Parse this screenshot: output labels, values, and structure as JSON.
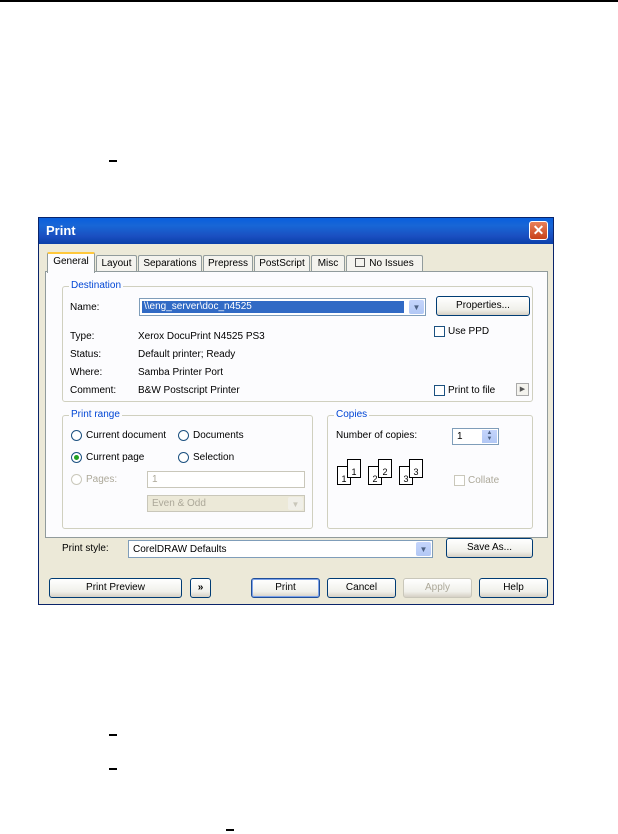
{
  "dialog": {
    "title": "Print",
    "close_glyph": "✕",
    "tabs": [
      {
        "label": "General"
      },
      {
        "label": "Layout"
      },
      {
        "label": "Separations"
      },
      {
        "label": "Prepress"
      },
      {
        "label": "PostScript"
      },
      {
        "label": "Misc"
      },
      {
        "label": "No Issues",
        "icon": "issues-icon"
      }
    ],
    "destination": {
      "legend": "Destination",
      "name_label": "Name:",
      "name_value": "\\\\eng_server\\doc_n4525",
      "properties_button": "Properties...",
      "type_label": "Type:",
      "type_value": "Xerox DocuPrint N4525 PS3",
      "status_label": "Status:",
      "status_value": "Default printer; Ready",
      "where_label": "Where:",
      "where_value": "Samba Printer Port",
      "comment_label": "Comment:",
      "comment_value": "B&W Postscript Printer",
      "use_ppd_label": "Use PPD",
      "print_to_file_label": "Print to file"
    },
    "print_range": {
      "legend": "Print range",
      "current_document": "Current document",
      "documents": "Documents",
      "current_page": "Current page",
      "selection": "Selection",
      "pages_label": "Pages:",
      "pages_value": "1",
      "even_odd_value": "Even & Odd",
      "selected": "current_page"
    },
    "copies": {
      "legend": "Copies",
      "number_label": "Number of copies:",
      "number_value": "1",
      "collate_label": "Collate",
      "page_numbers": [
        "1",
        "1",
        "2",
        "2",
        "3",
        "3"
      ]
    },
    "print_style": {
      "label": "Print style:",
      "value": "CorelDRAW Defaults",
      "save_as_button": "Save As..."
    },
    "buttons": {
      "print_preview": "Print Preview",
      "expand_glyph": "»",
      "print": "Print",
      "cancel": "Cancel",
      "apply": "Apply",
      "help": "Help"
    },
    "colors": {
      "titlebar": "#0A5FDD",
      "dialog_bg": "#ECE9D8",
      "legend_text": "#0046D5",
      "selected_field": "#316AC5",
      "active_tab_accent": "#FFC83C"
    }
  }
}
